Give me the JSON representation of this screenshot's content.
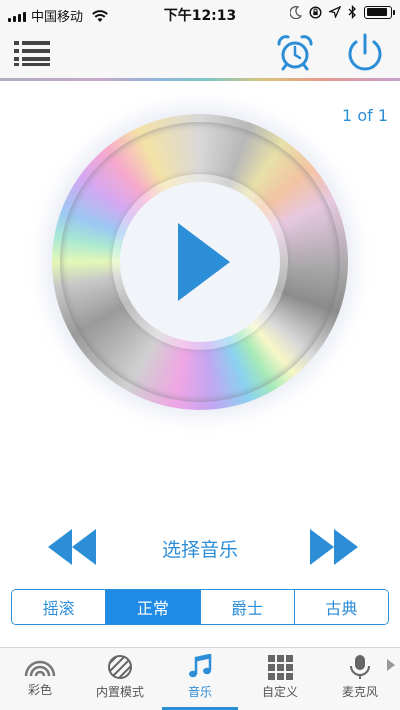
{
  "status_bar": {
    "carrier": "中国移动",
    "time": "下午12:13"
  },
  "nav": {
    "menu_icon": "list-icon",
    "alarm_icon": "alarm-clock-icon",
    "power_icon": "power-icon"
  },
  "player": {
    "page_count": "1 of 1",
    "play_icon": "play-icon",
    "choose_music_label": "选择音乐",
    "prev_icon": "rewind-icon",
    "next_icon": "fast-forward-icon"
  },
  "styles": {
    "options": [
      "摇滚",
      "正常",
      "爵士",
      "古典"
    ],
    "selected": "正常"
  },
  "tabs": [
    {
      "label": "彩色",
      "icon": "rainbow-icon"
    },
    {
      "label": "内置模式",
      "icon": "stripes-icon"
    },
    {
      "label": "音乐",
      "icon": "music-note-icon",
      "active": true
    },
    {
      "label": "自定义",
      "icon": "grid-icon"
    },
    {
      "label": "麦克风",
      "icon": "microphone-icon"
    }
  ],
  "colors": {
    "accent": "#2d8ed8",
    "active_segment": "#1f8be6",
    "tab_bar_bg": "#f7f7f7"
  }
}
